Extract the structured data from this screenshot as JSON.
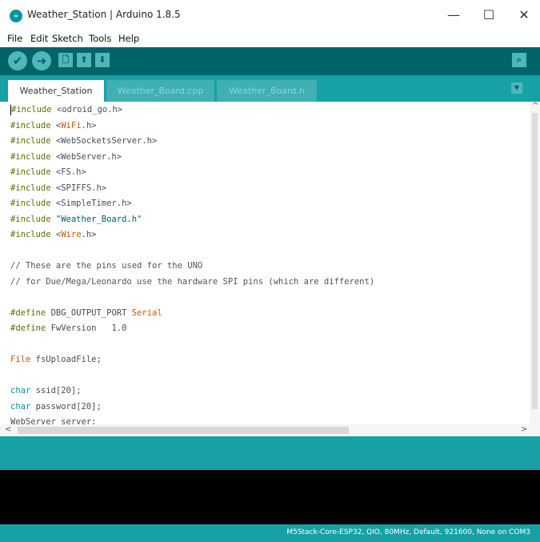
{
  "window": {
    "title": "Weather_Station | Arduino 1.8.5",
    "app_icon": "arduino-icon",
    "controls": {
      "minimize": "—",
      "maximize": "☐",
      "close": "✕"
    }
  },
  "menu": {
    "items": [
      "File",
      "Edit",
      "Sketch",
      "Tools",
      "Help"
    ]
  },
  "toolbar": {
    "buttons": [
      {
        "name": "verify",
        "icon": "✔"
      },
      {
        "name": "upload",
        "icon": "➜"
      },
      {
        "name": "new",
        "icon": "🗋"
      },
      {
        "name": "open",
        "icon": "⬆"
      },
      {
        "name": "save",
        "icon": "⬇"
      }
    ],
    "serial_monitor_icon": "⌕"
  },
  "tabs": [
    {
      "label": "Weather_Station",
      "active": true
    },
    {
      "label": "Weather_Board.cpp",
      "active": false
    },
    {
      "label": "Weather_Board.h",
      "active": false
    }
  ],
  "tab_menu_icon": "▼",
  "code": {
    "l1": {
      "kw": "#include",
      "rest": " <odroid_go.h>"
    },
    "l2": {
      "kw": "#include",
      "space": " <",
      "lib": "WiFi",
      "end": ".h>"
    },
    "l3": {
      "kw": "#include",
      "rest": " <WebSocketsServer.h>"
    },
    "l4": {
      "kw": "#include",
      "rest": " <WebServer.h>"
    },
    "l5": {
      "kw": "#include",
      "rest": " <FS.h>"
    },
    "l6": {
      "kw": "#include",
      "rest": " <SPIFFS.h>"
    },
    "l7": {
      "kw": "#include",
      "rest": " <SimpleTimer.h>"
    },
    "l8": {
      "kw": "#include",
      "str": " \"Weather_Board.h\""
    },
    "l9": {
      "kw": "#include",
      "space": " <",
      "lib": "Wire",
      "end": ".h>"
    },
    "l11": {
      "comment": "// These are the pins used for the UNO"
    },
    "l12": {
      "comment": "// for Due/Mega/Leonardo use the hardware SPI pins (which are different)"
    },
    "l14": {
      "kw": "#define",
      "mid": " DBG_OUTPUT_PORT ",
      "lib": "Serial"
    },
    "l15": {
      "kw": "#define",
      "rest": " FwVersion   1.0"
    },
    "l17": {
      "type": "File",
      "rest": " fsUploadFile;"
    },
    "l19": {
      "type": "char",
      "rest": " ssid[20];"
    },
    "l20": {
      "type": "char",
      "rest": " password[20];"
    },
    "l21": {
      "rest": "WebServer server;"
    }
  },
  "scroll": {
    "left_arrow": "<",
    "right_arrow": ">",
    "up_arrow": "^"
  },
  "footer": {
    "board_info": "M5Stack-Core-ESP32, QIO, 80MHz, Default, 921600, None on COM3"
  },
  "colors": {
    "toolbar": "#006468",
    "tabbar": "#17a1a5",
    "console": "#000000",
    "keyword": "#5e6d03",
    "type": "#00979c",
    "library": "#d35400"
  }
}
